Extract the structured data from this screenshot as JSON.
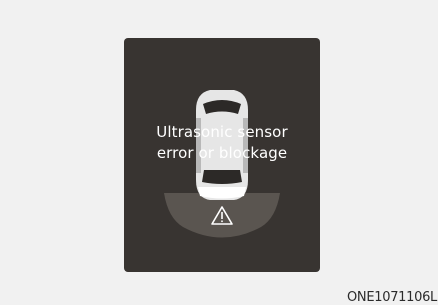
{
  "display": {
    "message_line1": "Ultrasonic sensor",
    "message_line2": "error or blockage",
    "icons": [
      "car-top-view-icon",
      "sensor-zone-icon",
      "warning-triangle-icon"
    ],
    "colors": {
      "panel_bg": "#383431",
      "page_bg": "#f1f1f1",
      "text": "#ffffff",
      "sensor_zone": "#5a5550",
      "car_body": "#e6e6e6"
    }
  },
  "figure_code": "ONE1071106L"
}
